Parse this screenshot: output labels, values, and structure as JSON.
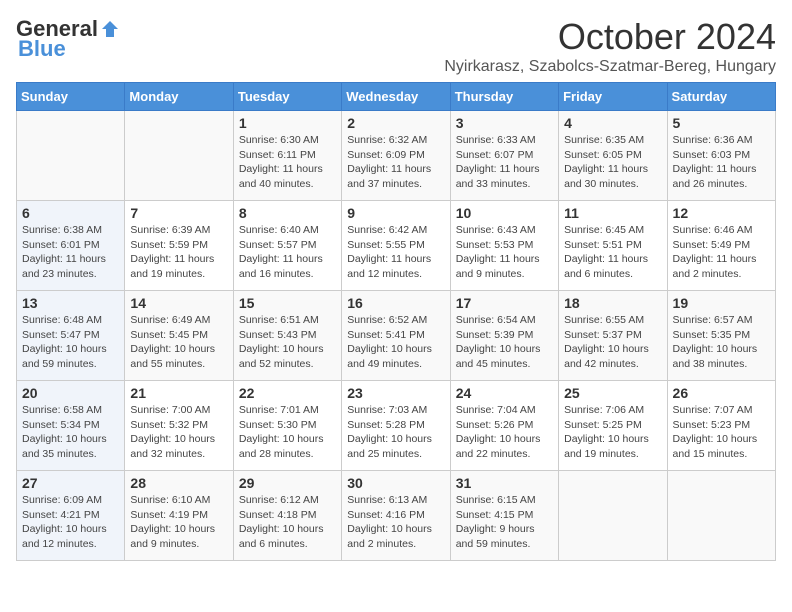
{
  "header": {
    "logo_general": "General",
    "logo_blue": "Blue",
    "month": "October 2024",
    "location": "Nyirkarasz, Szabolcs-Szatmar-Bereg, Hungary"
  },
  "weekdays": [
    "Sunday",
    "Monday",
    "Tuesday",
    "Wednesday",
    "Thursday",
    "Friday",
    "Saturday"
  ],
  "weeks": [
    [
      {
        "day": "",
        "info": ""
      },
      {
        "day": "",
        "info": ""
      },
      {
        "day": "1",
        "info": "Sunrise: 6:30 AM\nSunset: 6:11 PM\nDaylight: 11 hours\nand 40 minutes."
      },
      {
        "day": "2",
        "info": "Sunrise: 6:32 AM\nSunset: 6:09 PM\nDaylight: 11 hours\nand 37 minutes."
      },
      {
        "day": "3",
        "info": "Sunrise: 6:33 AM\nSunset: 6:07 PM\nDaylight: 11 hours\nand 33 minutes."
      },
      {
        "day": "4",
        "info": "Sunrise: 6:35 AM\nSunset: 6:05 PM\nDaylight: 11 hours\nand 30 minutes."
      },
      {
        "day": "5",
        "info": "Sunrise: 6:36 AM\nSunset: 6:03 PM\nDaylight: 11 hours\nand 26 minutes."
      }
    ],
    [
      {
        "day": "6",
        "info": "Sunrise: 6:38 AM\nSunset: 6:01 PM\nDaylight: 11 hours\nand 23 minutes."
      },
      {
        "day": "7",
        "info": "Sunrise: 6:39 AM\nSunset: 5:59 PM\nDaylight: 11 hours\nand 19 minutes."
      },
      {
        "day": "8",
        "info": "Sunrise: 6:40 AM\nSunset: 5:57 PM\nDaylight: 11 hours\nand 16 minutes."
      },
      {
        "day": "9",
        "info": "Sunrise: 6:42 AM\nSunset: 5:55 PM\nDaylight: 11 hours\nand 12 minutes."
      },
      {
        "day": "10",
        "info": "Sunrise: 6:43 AM\nSunset: 5:53 PM\nDaylight: 11 hours\nand 9 minutes."
      },
      {
        "day": "11",
        "info": "Sunrise: 6:45 AM\nSunset: 5:51 PM\nDaylight: 11 hours\nand 6 minutes."
      },
      {
        "day": "12",
        "info": "Sunrise: 6:46 AM\nSunset: 5:49 PM\nDaylight: 11 hours\nand 2 minutes."
      }
    ],
    [
      {
        "day": "13",
        "info": "Sunrise: 6:48 AM\nSunset: 5:47 PM\nDaylight: 10 hours\nand 59 minutes."
      },
      {
        "day": "14",
        "info": "Sunrise: 6:49 AM\nSunset: 5:45 PM\nDaylight: 10 hours\nand 55 minutes."
      },
      {
        "day": "15",
        "info": "Sunrise: 6:51 AM\nSunset: 5:43 PM\nDaylight: 10 hours\nand 52 minutes."
      },
      {
        "day": "16",
        "info": "Sunrise: 6:52 AM\nSunset: 5:41 PM\nDaylight: 10 hours\nand 49 minutes."
      },
      {
        "day": "17",
        "info": "Sunrise: 6:54 AM\nSunset: 5:39 PM\nDaylight: 10 hours\nand 45 minutes."
      },
      {
        "day": "18",
        "info": "Sunrise: 6:55 AM\nSunset: 5:37 PM\nDaylight: 10 hours\nand 42 minutes."
      },
      {
        "day": "19",
        "info": "Sunrise: 6:57 AM\nSunset: 5:35 PM\nDaylight: 10 hours\nand 38 minutes."
      }
    ],
    [
      {
        "day": "20",
        "info": "Sunrise: 6:58 AM\nSunset: 5:34 PM\nDaylight: 10 hours\nand 35 minutes."
      },
      {
        "day": "21",
        "info": "Sunrise: 7:00 AM\nSunset: 5:32 PM\nDaylight: 10 hours\nand 32 minutes."
      },
      {
        "day": "22",
        "info": "Sunrise: 7:01 AM\nSunset: 5:30 PM\nDaylight: 10 hours\nand 28 minutes."
      },
      {
        "day": "23",
        "info": "Sunrise: 7:03 AM\nSunset: 5:28 PM\nDaylight: 10 hours\nand 25 minutes."
      },
      {
        "day": "24",
        "info": "Sunrise: 7:04 AM\nSunset: 5:26 PM\nDaylight: 10 hours\nand 22 minutes."
      },
      {
        "day": "25",
        "info": "Sunrise: 7:06 AM\nSunset: 5:25 PM\nDaylight: 10 hours\nand 19 minutes."
      },
      {
        "day": "26",
        "info": "Sunrise: 7:07 AM\nSunset: 5:23 PM\nDaylight: 10 hours\nand 15 minutes."
      }
    ],
    [
      {
        "day": "27",
        "info": "Sunrise: 6:09 AM\nSunset: 4:21 PM\nDaylight: 10 hours\nand 12 minutes."
      },
      {
        "day": "28",
        "info": "Sunrise: 6:10 AM\nSunset: 4:19 PM\nDaylight: 10 hours\nand 9 minutes."
      },
      {
        "day": "29",
        "info": "Sunrise: 6:12 AM\nSunset: 4:18 PM\nDaylight: 10 hours\nand 6 minutes."
      },
      {
        "day": "30",
        "info": "Sunrise: 6:13 AM\nSunset: 4:16 PM\nDaylight: 10 hours\nand 2 minutes."
      },
      {
        "day": "31",
        "info": "Sunrise: 6:15 AM\nSunset: 4:15 PM\nDaylight: 9 hours\nand 59 minutes."
      },
      {
        "day": "",
        "info": ""
      },
      {
        "day": "",
        "info": ""
      }
    ]
  ]
}
